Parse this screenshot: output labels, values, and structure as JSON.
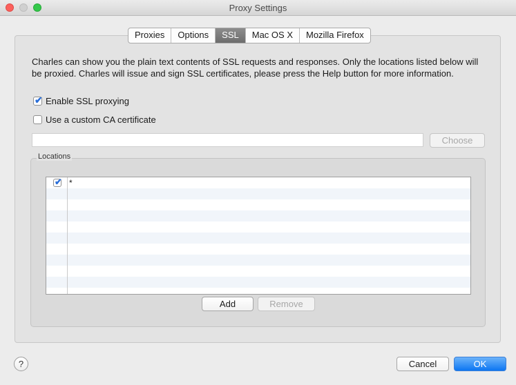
{
  "window": {
    "title": "Proxy Settings"
  },
  "tabs": [
    {
      "label": "Proxies"
    },
    {
      "label": "Options"
    },
    {
      "label": "SSL"
    },
    {
      "label": "Mac OS X"
    },
    {
      "label": "Mozilla Firefox"
    }
  ],
  "selected_tab": "SSL",
  "ssl": {
    "description": "Charles can show you the plain text contents of SSL requests and responses. Only the locations listed below will be proxied. Charles will issue and sign SSL certificates, please press the Help button for more information.",
    "enable_ssl_label": "Enable SSL proxying",
    "enable_ssl_checked": true,
    "custom_ca_label": "Use a custom CA certificate",
    "custom_ca_checked": false,
    "cert_path_value": "",
    "choose_label": "Choose"
  },
  "locations": {
    "title": "Locations",
    "rows": [
      {
        "enabled": true,
        "location": "*"
      }
    ],
    "add_label": "Add",
    "remove_label": "Remove"
  },
  "footer": {
    "help_label": "?",
    "cancel_label": "Cancel",
    "ok_label": "OK"
  }
}
